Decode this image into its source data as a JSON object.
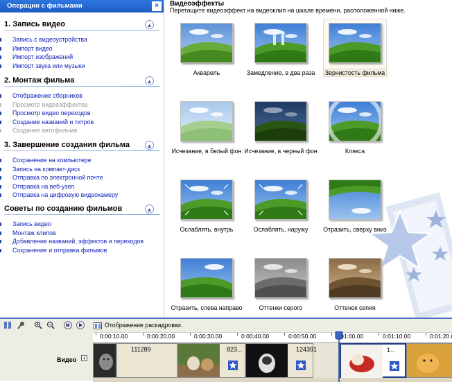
{
  "task_pane": {
    "title": "Операции с фильмами",
    "close": "×",
    "sections": [
      {
        "title": "1. Запись видео",
        "items": [
          {
            "label": "Запись с видеоустройства",
            "enabled": true
          },
          {
            "label": "Импорт видео",
            "enabled": true
          },
          {
            "label": "Импорт изображений",
            "enabled": true
          },
          {
            "label": "Импорт звука или музыки",
            "enabled": true
          }
        ]
      },
      {
        "title": "2. Монтаж фильма",
        "items": [
          {
            "label": "Отображение сборников",
            "enabled": true
          },
          {
            "label": "Просмотр видеоэффектов",
            "enabled": false
          },
          {
            "label": "Просмотр видео переходов",
            "enabled": true
          },
          {
            "label": "Создание названий и титров",
            "enabled": true
          },
          {
            "label": "Создание автофильма",
            "enabled": false
          }
        ]
      },
      {
        "title": "3. Завершение создания фильма",
        "items": [
          {
            "label": "Сохранение на компьютере",
            "enabled": true
          },
          {
            "label": "Запись на компакт-диск",
            "enabled": true
          },
          {
            "label": "Отправка по электронной почте",
            "enabled": true
          },
          {
            "label": "Отправка на веб-узел",
            "enabled": true
          },
          {
            "label": "Отправка на цифровую видеокамеру",
            "enabled": true
          }
        ]
      },
      {
        "title": "Советы по созданию фильмов",
        "items": [
          {
            "label": "Запись видео",
            "enabled": true
          },
          {
            "label": "Монтаж клипов",
            "enabled": true
          },
          {
            "label": "Добавление названий, эффектов и переходов",
            "enabled": true
          },
          {
            "label": "Сохранение и отправка фильмов",
            "enabled": true
          }
        ]
      }
    ]
  },
  "effects": {
    "title": "Видеоэффекты",
    "subtitle": "Перетащите видеоэффект на видеоклип на шкале времени, расположенной ниже.",
    "selected": "Зернистость фильма",
    "items": [
      {
        "label": "Акварель",
        "style": "watercolor"
      },
      {
        "label": "Замедление, в два раза",
        "style": "slowdown"
      },
      {
        "label": "Зернистость фильма",
        "style": "grain"
      },
      {
        "label": "Исчезание, в белый фон",
        "style": "fade-white"
      },
      {
        "label": "Исчезание, в черный фон",
        "style": "fade-black"
      },
      {
        "label": "Клякса",
        "style": "blot"
      },
      {
        "label": "Ослаблять, внутрь",
        "style": "ease-in"
      },
      {
        "label": "Ослаблять, наружу",
        "style": "ease-out"
      },
      {
        "label": "Отразить, сверху вниз",
        "style": "flip-vertical"
      },
      {
        "label": "Отразить, слева направо",
        "style": "flip-horizontal"
      },
      {
        "label": "Оттенки серого",
        "style": "grayscale"
      },
      {
        "label": "Оттенок сепия",
        "style": "sepia"
      }
    ]
  },
  "timeline": {
    "storyboard_label": "Отображение раскадровки.",
    "ruler_ticks": [
      "0:00:10.00",
      "0:00:20.00",
      "0:00:30.00",
      "0:00:40.00",
      "0:00:50.00",
      "0:01:00.00",
      "0:01:10.00",
      "0:01:20.00"
    ],
    "track_label": "Видео",
    "expand": "+",
    "clips": [
      {
        "name": "",
        "image": "gray-cat"
      },
      {
        "name": "111289",
        "image": ""
      },
      {
        "name": "823...",
        "image": "cats-garden"
      },
      {
        "name": "124391",
        "image": "black-cat"
      },
      {
        "name": "1...",
        "image": "cat-red"
      },
      {
        "name": "",
        "image": "kitten-orange"
      }
    ]
  },
  "colors": {
    "accent": "#2e76df",
    "link": "#1122bb",
    "disabled": "#9a9a9a",
    "timeline_bg": "#eeede4"
  },
  "icons": [
    "storyboard-icon",
    "microphone-icon",
    "zoom-in-icon",
    "zoom-out-icon",
    "rewind-icon",
    "play-icon",
    "collapse-icon",
    "effect-star-icon"
  ]
}
